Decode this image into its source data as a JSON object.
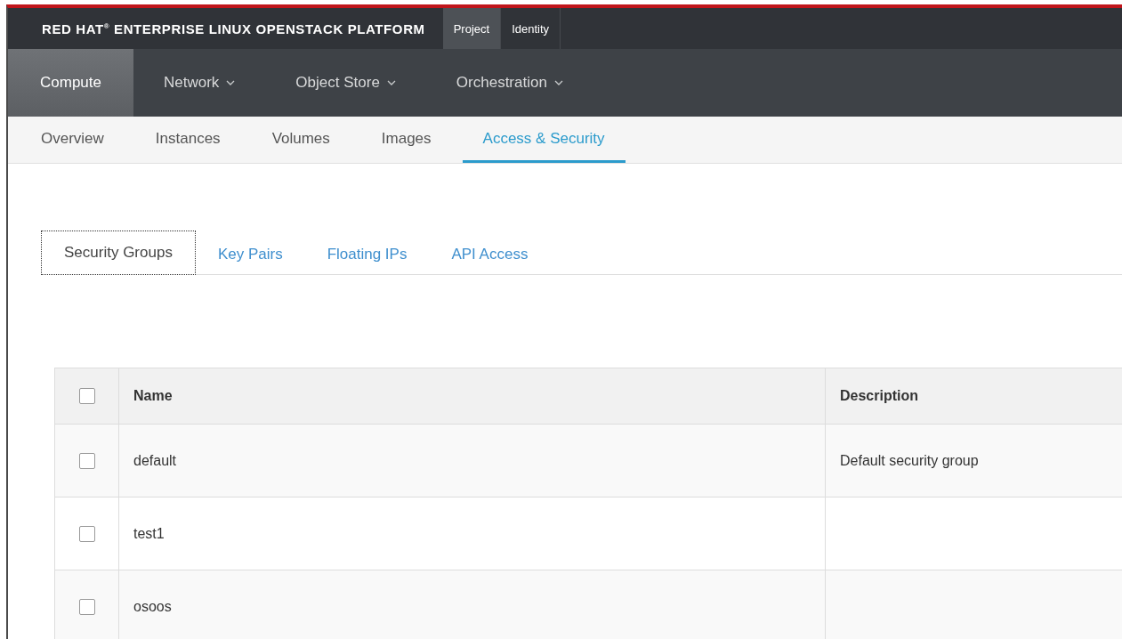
{
  "brand": "RED HAT$^{®}$ ENTERPRISE LINUX OPENSTACK PLATFORM",
  "top_tabs": [
    {
      "label": "Project",
      "selected": true
    },
    {
      "label": "Identity",
      "selected": false
    }
  ],
  "nav": [
    {
      "label": "Compute",
      "selected": true,
      "dropdown": false
    },
    {
      "label": "Network",
      "selected": false,
      "dropdown": true
    },
    {
      "label": "Object Store",
      "selected": false,
      "dropdown": true
    },
    {
      "label": "Orchestration",
      "selected": false,
      "dropdown": true
    }
  ],
  "subnav": [
    {
      "label": "Overview",
      "selected": false
    },
    {
      "label": "Instances",
      "selected": false
    },
    {
      "label": "Volumes",
      "selected": false
    },
    {
      "label": "Images",
      "selected": false
    },
    {
      "label": "Access & Security",
      "selected": true
    }
  ],
  "tabs": [
    {
      "label": "Security Groups",
      "selected": true
    },
    {
      "label": "Key Pairs",
      "selected": false
    },
    {
      "label": "Floating IPs",
      "selected": false
    },
    {
      "label": "API Access",
      "selected": false
    }
  ],
  "table": {
    "columns": [
      "Name",
      "Description"
    ],
    "header_checked": false,
    "rows": [
      {
        "checked": false,
        "cells": [
          "default",
          "Default security group"
        ]
      },
      {
        "checked": false,
        "cells": [
          "test1",
          ""
        ]
      },
      {
        "checked": false,
        "cells": [
          "osoos",
          ""
        ]
      }
    ]
  }
}
